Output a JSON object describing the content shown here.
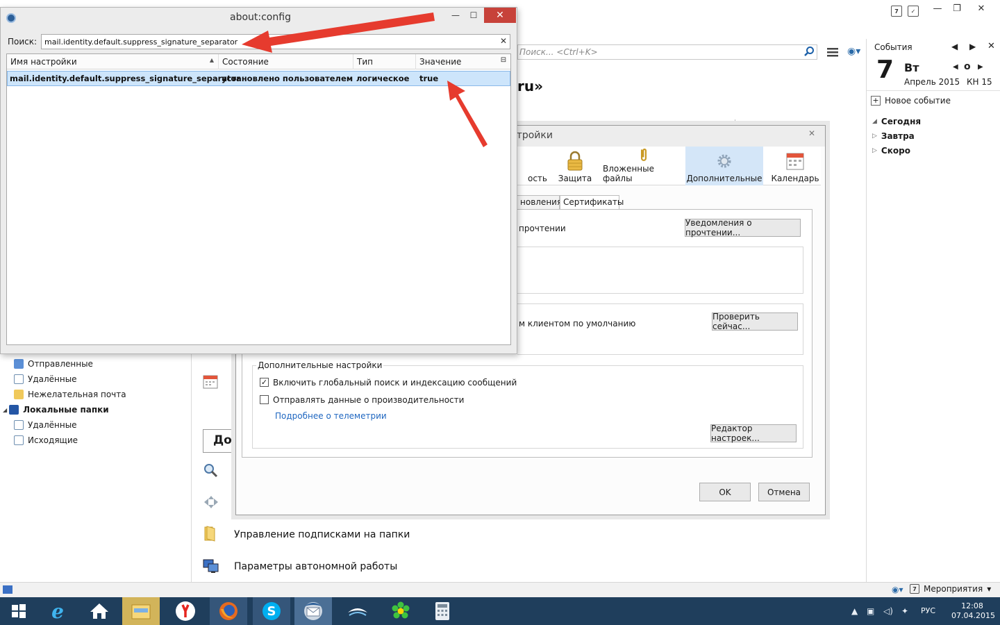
{
  "aboutconfig": {
    "title": "about:config",
    "search_label": "Поиск:",
    "search_value": "mail.identity.default.suppress_signature_separator",
    "columns": [
      "Имя настройки",
      "Состояние",
      "Тип",
      "Значение"
    ],
    "row": {
      "name": "mail.identity.default.suppress_signature_separator",
      "state": "установлено пользователем",
      "type": "логическое",
      "value": "true"
    }
  },
  "main": {
    "quick_search_placeholder": "Поиск... <Ctrl+K>",
    "account_heading_fragment": "ru»"
  },
  "options": {
    "title_fragment": "стройки",
    "toolbar": [
      {
        "label": "ость",
        "icon": "privacy-icon"
      },
      {
        "label": "Защита",
        "icon": "lock-icon"
      },
      {
        "label": "Вложенные файлы",
        "icon": "paperclip-icon"
      },
      {
        "label": "Дополнительные",
        "icon": "gear-icon"
      },
      {
        "label": "Календарь",
        "icon": "calendar-icon"
      }
    ],
    "tabs": [
      "новления",
      "Сертификаты"
    ],
    "read_receipts_fragment": "прочтении",
    "read_receipts_button": "Уведомления о прочтении...",
    "default_client_fragment": "м клиентом по умолчанию",
    "check_now_button": "Проверить сейчас...",
    "advanced_group_title": "Дополнительные настройки",
    "global_search_label": "Включить глобальный поиск и индексацию сообщений",
    "global_search_checked": true,
    "telemetry_label": "Отправлять данные о производительности",
    "telemetry_checked": false,
    "telemetry_link": "Подробнее о телеметрии",
    "config_editor_button": "Редактор настроек...",
    "ok_button": "OK",
    "cancel_button": "Отмена"
  },
  "folders": [
    {
      "label": "Отправленные",
      "icon": "sent-folder-icon",
      "bold": false
    },
    {
      "label": "Удалённые",
      "icon": "trash-folder-icon",
      "bold": false
    },
    {
      "label": "Нежелательная почта",
      "icon": "junk-folder-icon",
      "bold": false
    },
    {
      "label": "Локальные папки",
      "icon": "local-folders-icon",
      "bold": true
    },
    {
      "label": "Удалённые",
      "icon": "trash-folder-icon",
      "bold": false
    },
    {
      "label": "Исходящие",
      "icon": "outbox-folder-icon",
      "bold": false
    }
  ],
  "central": {
    "do_button_fragment": "До",
    "subscribe_label": "Управление подписками на папки",
    "offline_label": "Параметры автономной работы"
  },
  "events": {
    "title": "События",
    "day_number": "7",
    "weekday": "Вт",
    "month_year": "Апрель 2015",
    "week": "КН 15",
    "new_event": "Новое событие",
    "groups": [
      "Сегодня",
      "Завтра",
      "Скоро"
    ]
  },
  "statusbar": {
    "dropdown": "Мероприятия"
  },
  "taskbar": {
    "language": "РУС",
    "time": "12:08",
    "date": "07.04.2015"
  },
  "colors": {
    "arrow": "#e63b2e",
    "taskbar": "#1f3e5c",
    "selection": "#cde5fb"
  }
}
